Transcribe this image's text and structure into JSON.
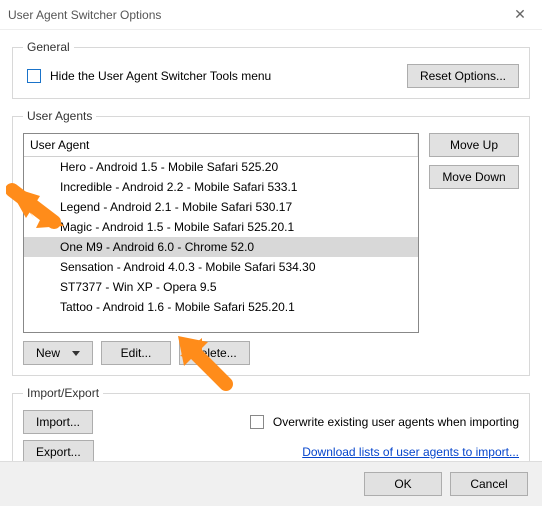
{
  "window": {
    "title": "User Agent Switcher Options",
    "close_glyph": "✕"
  },
  "general": {
    "legend": "General",
    "hide_label": "Hide the User Agent Switcher Tools menu",
    "reset_label": "Reset Options..."
  },
  "user_agents": {
    "legend": "User Agents",
    "header": "User Agent",
    "move_up": "Move Up",
    "move_down": "Move Down",
    "new_label": "New",
    "edit_label": "Edit...",
    "delete_label": "Delete...",
    "items": [
      {
        "label": "Hero - Android 1.5 - Mobile Safari 525.20",
        "selected": false
      },
      {
        "label": "Incredible - Android 2.2 - Mobile Safari 533.1",
        "selected": false
      },
      {
        "label": "Legend - Android 2.1 - Mobile Safari 530.17",
        "selected": false
      },
      {
        "label": "Magic - Android 1.5 - Mobile Safari 525.20.1",
        "selected": false
      },
      {
        "label": "One M9 - Android 6.0 - Chrome 52.0",
        "selected": true
      },
      {
        "label": "Sensation - Android 4.0.3 - Mobile Safari 534.30",
        "selected": false
      },
      {
        "label": "ST7377 - Win XP - Opera 9.5",
        "selected": false
      },
      {
        "label": "Tattoo - Android 1.6 - Mobile Safari 525.20.1",
        "selected": false
      }
    ]
  },
  "import_export": {
    "legend": "Import/Export",
    "import_label": "Import...",
    "export_label": "Export...",
    "overwrite_label": "Overwrite existing user agents when importing",
    "download_link": "Download lists of user agents to import..."
  },
  "footer": {
    "ok": "OK",
    "cancel": "Cancel"
  }
}
